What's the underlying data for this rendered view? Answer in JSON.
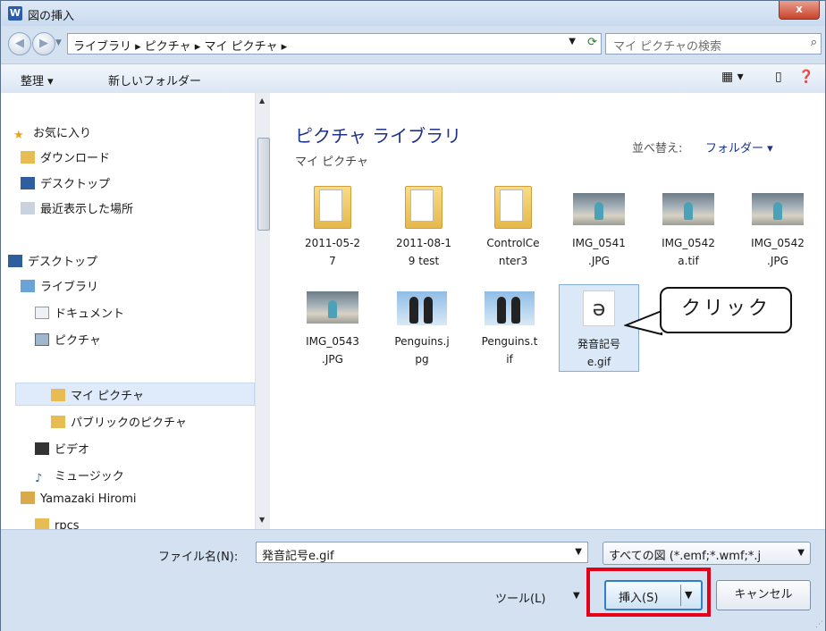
{
  "window": {
    "title": "図の挿入",
    "app_icon": "W",
    "close_label": "x"
  },
  "address": {
    "crumbs": "ライブラリ ▸ ピクチャ ▸ マイ ピクチャ ▸",
    "search_placeholder": "マイ ピクチャの検索"
  },
  "toolbar": {
    "organize": "整理 ▾",
    "new_folder": "新しいフォルダー"
  },
  "nav": {
    "favorites": "お気に入り",
    "downloads": "ダウンロード",
    "desktop_fav": "デスクトップ",
    "recent": "最近表示した場所",
    "desktop": "デスクトップ",
    "libraries": "ライブラリ",
    "documents": "ドキュメント",
    "pictures": "ピクチャ",
    "my_pictures": "マイ ピクチャ",
    "public_pictures": "パブリックのピクチャ",
    "videos": "ビデオ",
    "music": "ミュージック",
    "user": "Yamazaki Hiromi",
    "rpcs": "rpcs"
  },
  "content": {
    "title": "ピクチャ ライブラリ",
    "subtitle": "マイ ピクチャ",
    "sort_label": "並べ替え:",
    "sort_value": "フォルダー ▾",
    "files": [
      {
        "line1": "2011-05-2",
        "line2": "7"
      },
      {
        "line1": "2011-08-1",
        "line2": "9 test"
      },
      {
        "line1": "ControlCe",
        "line2": "nter3"
      },
      {
        "line1": "IMG_0541",
        "line2": ".JPG"
      },
      {
        "line1": "IMG_0542",
        "line2": "a.tif"
      },
      {
        "line1": "IMG_0542",
        "line2": ".JPG"
      },
      {
        "line1": "IMG_0543",
        "line2": ".JPG"
      },
      {
        "line1": "Penguins.j",
        "line2": "pg"
      },
      {
        "line1": "Penguins.t",
        "line2": "if"
      },
      {
        "line1": "発音記号",
        "line2": "e.gif",
        "glyph": "ə"
      }
    ]
  },
  "annotation": {
    "callout": "クリック"
  },
  "bottom": {
    "filename_label": "ファイル名(N):",
    "filename_value": "発音記号e.gif",
    "filter": "すべての図 (*.emf;*.wmf;*.j",
    "tools": "ツール(L)",
    "insert": "挿入(S)",
    "cancel": "キャンセル"
  }
}
